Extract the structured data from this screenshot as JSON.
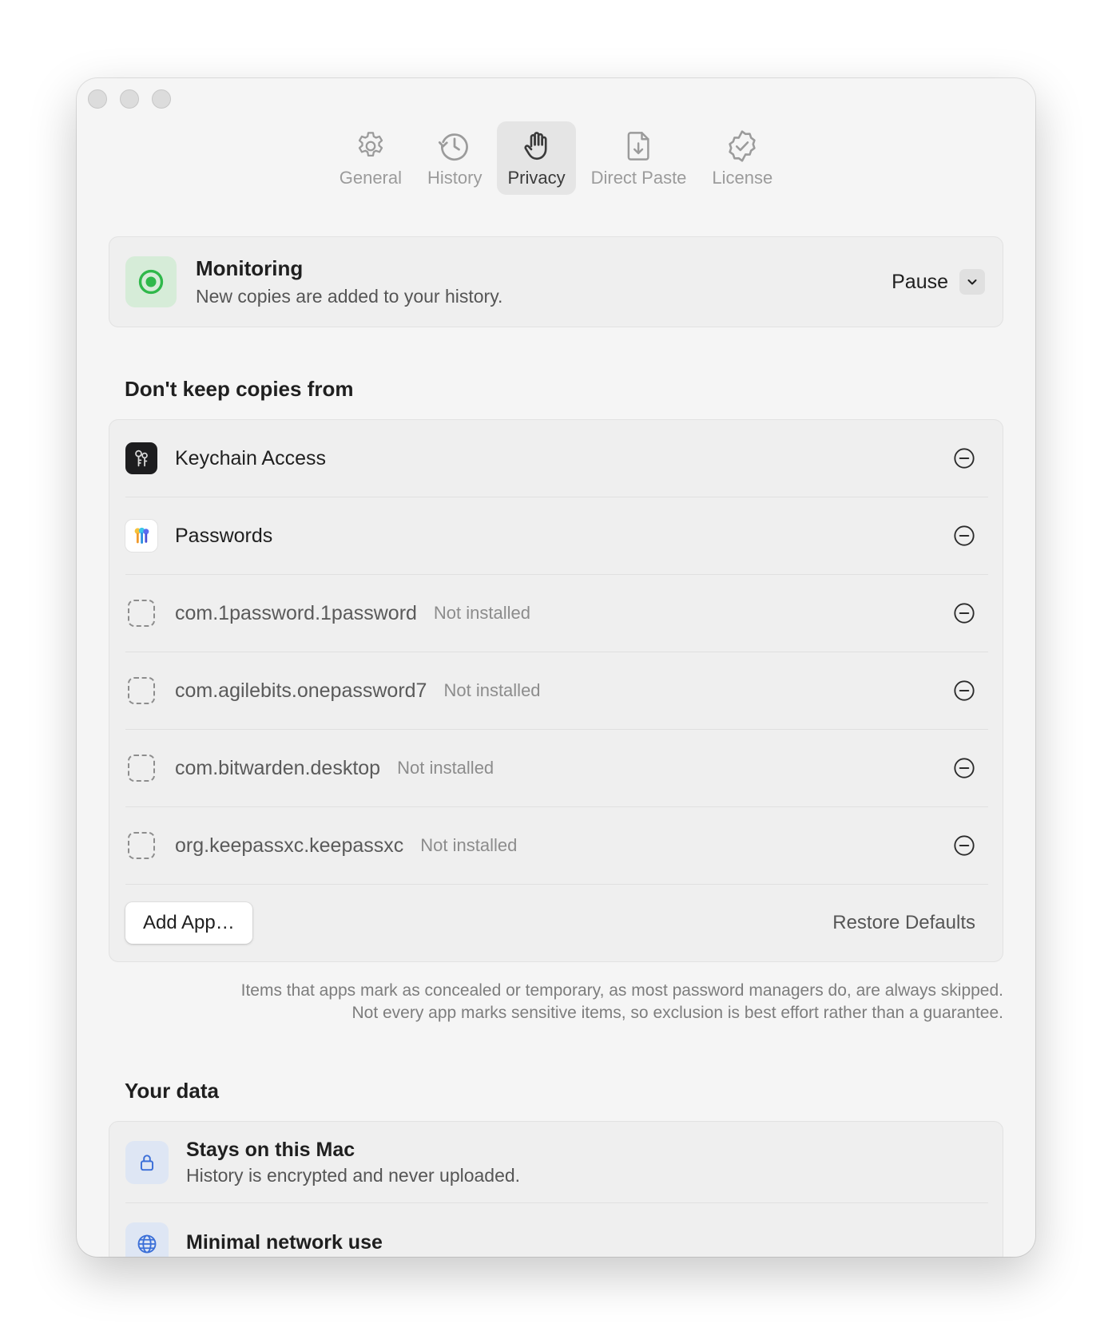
{
  "tabs": [
    {
      "label": "General",
      "icon": "gear-icon",
      "active": false
    },
    {
      "label": "History",
      "icon": "clock-icon",
      "active": false
    },
    {
      "label": "Privacy",
      "icon": "hand-icon",
      "active": true
    },
    {
      "label": "Direct Paste",
      "icon": "document-arrow-icon",
      "active": false
    },
    {
      "label": "License",
      "icon": "checkmark-seal-icon",
      "active": false
    }
  ],
  "monitoring": {
    "title": "Monitoring",
    "subtitle": "New copies are added to your history.",
    "pause_label": "Pause",
    "status_color": "#2fb84a"
  },
  "exclusions": {
    "heading": "Don't keep copies from",
    "apps": [
      {
        "name": "Keychain Access",
        "status": "",
        "icon": "keychain-icon"
      },
      {
        "name": "Passwords",
        "status": "",
        "icon": "passwords-key-icon"
      },
      {
        "name": "com.1password.1password",
        "status": "Not installed",
        "icon": "placeholder-app-icon"
      },
      {
        "name": "com.agilebits.onepassword7",
        "status": "Not installed",
        "icon": "placeholder-app-icon"
      },
      {
        "name": "com.bitwarden.desktop",
        "status": "Not installed",
        "icon": "placeholder-app-icon"
      },
      {
        "name": "org.keepassxc.keepassxc",
        "status": "Not installed",
        "icon": "placeholder-app-icon"
      }
    ],
    "add_label": "Add App…",
    "restore_label": "Restore Defaults",
    "footnote_line1": "Items that apps mark as concealed or temporary, as most password managers do, are always skipped.",
    "footnote_line2": "Not every app marks sensitive items, so exclusion is best effort rather than a guarantee."
  },
  "your_data": {
    "heading": "Your data",
    "items": [
      {
        "title": "Stays on this Mac",
        "subtitle": "History is encrypted and never uploaded.",
        "icon": "lock-icon"
      },
      {
        "title": "Minimal network use",
        "subtitle": "",
        "icon": "globe-icon"
      }
    ]
  },
  "accent_color": "#3b6fd8"
}
